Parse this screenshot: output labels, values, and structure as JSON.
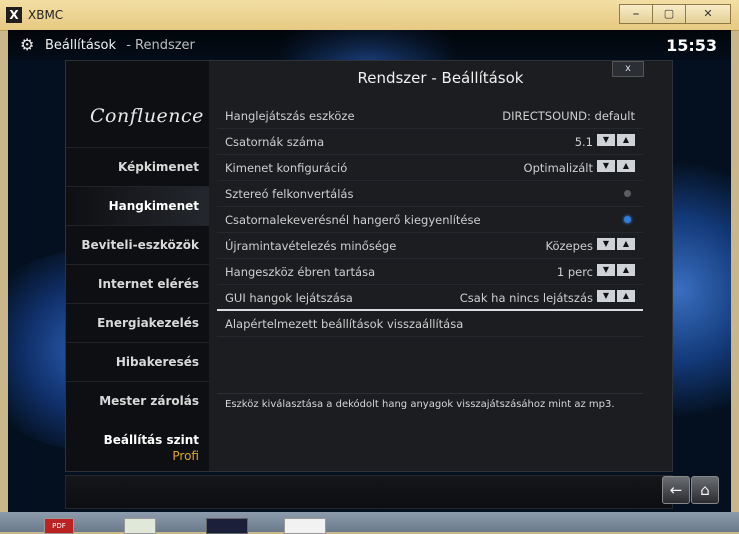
{
  "window": {
    "title": "XBMC",
    "app_icon": "X",
    "buttons": {
      "minimize": "⎯",
      "maximize": "▢",
      "close": "✕"
    }
  },
  "header": {
    "section": "Beállítások",
    "subsection": "- Rendszer",
    "clock": "15:53"
  },
  "sidebar": {
    "logo": "Confluence",
    "items": [
      {
        "label": "Képkimenet"
      },
      {
        "label": "Hangkimenet"
      },
      {
        "label": "Beviteli-eszközök"
      },
      {
        "label": "Internet elérés"
      },
      {
        "label": "Energiakezelés"
      },
      {
        "label": "Hibakeresés"
      },
      {
        "label": "Mester zárolás"
      }
    ],
    "active_index": 1,
    "level_title": "Beállítás szint",
    "level_value": "Profi"
  },
  "main": {
    "title": "Rendszer - Beállítások",
    "close_label": "x",
    "rows": [
      {
        "label": "Hanglejátszás eszköze",
        "value": "DIRECTSOUND: default",
        "control": "text"
      },
      {
        "label": "Csatornák száma",
        "value": "5.1",
        "control": "spin"
      },
      {
        "label": "Kimenet konfiguráció",
        "value": "Optimalizált",
        "control": "spin"
      },
      {
        "label": "Sztereó felkonvertálás",
        "value": "",
        "control": "radio",
        "checked": false
      },
      {
        "label": "Csatornalekeverésnél hangerő kiegyenlítése",
        "value": "",
        "control": "radio",
        "checked": true
      },
      {
        "label": "Újramintavételezés minősége",
        "value": "Közepes",
        "control": "spin"
      },
      {
        "label": "Hangeszköz ébren tartása",
        "value": "1 perc",
        "control": "spin"
      },
      {
        "label": "GUI hangok lejátszása",
        "value": "Csak ha nincs lejátszás",
        "control": "spin",
        "focused": true
      },
      {
        "label": "Alapértelmezett beállítások visszaállítása",
        "value": "",
        "control": "button"
      }
    ],
    "spin_up": "▼",
    "spin_down": "▲",
    "description": "Eszköz kiválasztása a dekódolt hang anyagok visszajátszásához mint az mp3."
  },
  "bottom": {
    "back_icon": "←",
    "home_icon": "⌂"
  },
  "taskbar": {
    "pdf_label": "PDF"
  },
  "colors": {
    "accent_blue": "#2f7ce0",
    "level_value": "#e0a72a"
  }
}
